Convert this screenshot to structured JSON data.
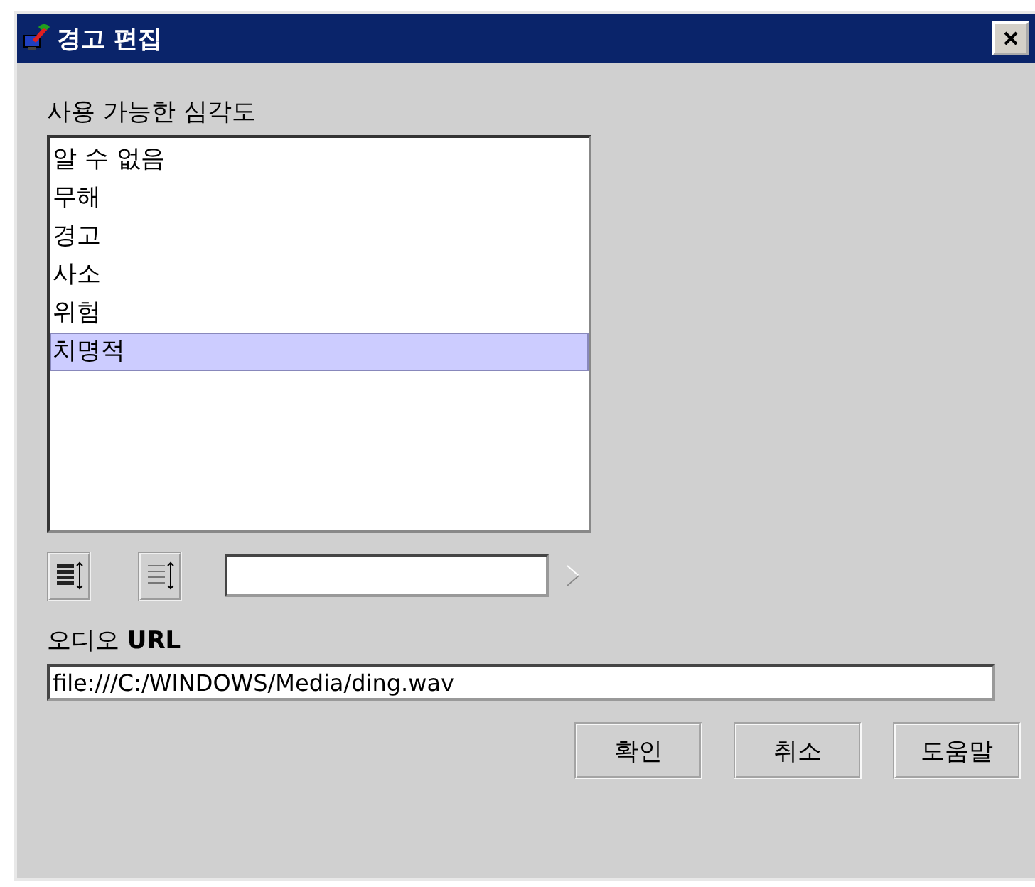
{
  "window": {
    "title": "경고 편집"
  },
  "severity_list": {
    "label": "사용 가능한 심각도",
    "items": [
      {
        "label": "알 수 없음",
        "selected": false
      },
      {
        "label": "무해",
        "selected": false
      },
      {
        "label": "경고",
        "selected": false
      },
      {
        "label": "사소",
        "selected": false
      },
      {
        "label": "위험",
        "selected": false
      },
      {
        "label": "치명적",
        "selected": true
      }
    ]
  },
  "audio_url": {
    "label": "오디오 **URL**",
    "value": "file:///C:/WINDOWS/Media/ding.wav"
  },
  "buttons": [
    "확인",
    "취소",
    "도움말"
  ]
}
